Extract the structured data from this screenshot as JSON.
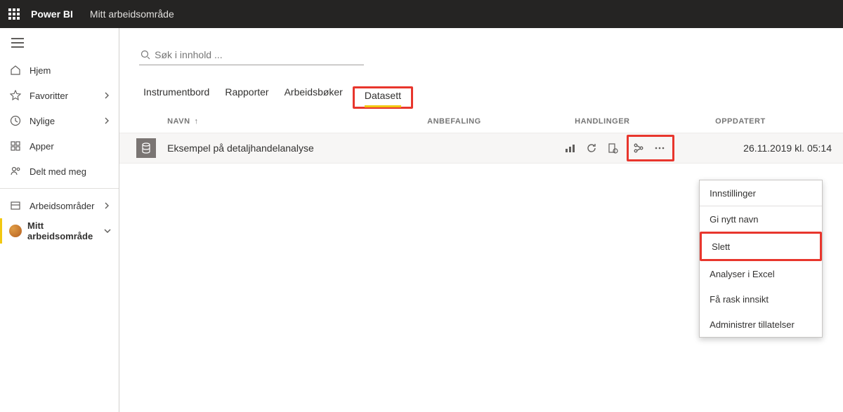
{
  "header": {
    "brand": "Power BI",
    "context": "Mitt arbeidsområde"
  },
  "sidebar": {
    "home": "Hjem",
    "favorites": "Favoritter",
    "recent": "Nylige",
    "apps": "Apper",
    "shared": "Delt med meg",
    "workspaces": "Arbeidsområder",
    "myworkspace": "Mitt arbeidsområde"
  },
  "search": {
    "placeholder": "Søk i innhold ..."
  },
  "tabs": {
    "dashboards": "Instrumentbord",
    "reports": "Rapporter",
    "workbooks": "Arbeidsbøker",
    "datasets": "Datasett"
  },
  "columns": {
    "name": "NAVN",
    "recommendation": "ANBEFALING",
    "actions": "HANDLINGER",
    "updated": "OPPDATERT"
  },
  "dataset": {
    "name": "Eksempel på detaljhandelanalyse",
    "updated": "26.11.2019 kl. 05:14"
  },
  "menu": {
    "settings": "Innstillinger",
    "rename": "Gi nytt navn",
    "delete": "Slett",
    "analyze": "Analyser i Excel",
    "insights": "Få rask innsikt",
    "permissions": "Administrer tillatelser"
  }
}
